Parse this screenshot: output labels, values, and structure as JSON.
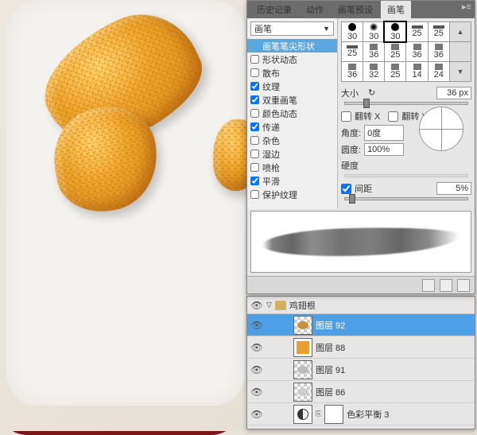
{
  "tabs": {
    "history": "历史记录",
    "actions": "动作",
    "brush_presets": "画笔预设",
    "brush": "画笔"
  },
  "dropdown": "画笔",
  "options": {
    "tip_shape": "画笔笔尖形状",
    "shape_dynamics": "形状动态",
    "scattering": "散布",
    "texture": "纹理",
    "dual_brush": "双重画笔",
    "color_dynamics": "颜色动态",
    "transfer": "传递",
    "noise": "杂色",
    "wet_edges": "湿边",
    "airbrush": "喷枪",
    "smoothing": "平滑",
    "protect_texture": "保护纹理"
  },
  "brush_tips": [
    {
      "v": "30",
      "t": "dot"
    },
    {
      "v": "30",
      "t": "soft"
    },
    {
      "v": "30",
      "t": "dot"
    },
    {
      "v": "25",
      "t": "bar"
    },
    {
      "v": "25",
      "t": "bar"
    },
    {
      "v": "",
      "t": "scroll"
    },
    {
      "v": "25",
      "t": "bar"
    },
    {
      "v": "36",
      "t": "misc"
    },
    {
      "v": "25",
      "t": "misc"
    },
    {
      "v": "36",
      "t": "misc"
    },
    {
      "v": "36",
      "t": "misc"
    },
    {
      "v": "",
      "t": "scroll"
    },
    {
      "v": "36",
      "t": "misc"
    },
    {
      "v": "32",
      "t": "misc"
    },
    {
      "v": "25",
      "t": "misc"
    },
    {
      "v": "14",
      "t": "misc"
    },
    {
      "v": "24",
      "t": "misc"
    },
    {
      "v": "",
      "t": "scroll"
    }
  ],
  "labels": {
    "size": "大小",
    "size_val": "36 px",
    "flip_x": "翻转 X",
    "flip_y": "翻转 Y",
    "angle": "角度:",
    "angle_val": "0度",
    "roundness": "圆度:",
    "roundness_val": "100%",
    "hardness": "硬度",
    "spacing": "间距",
    "spacing_val": "5%"
  },
  "layers": {
    "group": "鸡翅根",
    "l1": "图层 92",
    "l2": "图层 88",
    "l3": "图层 91",
    "l4": "图层 86",
    "l5": "色彩平衡 3"
  }
}
